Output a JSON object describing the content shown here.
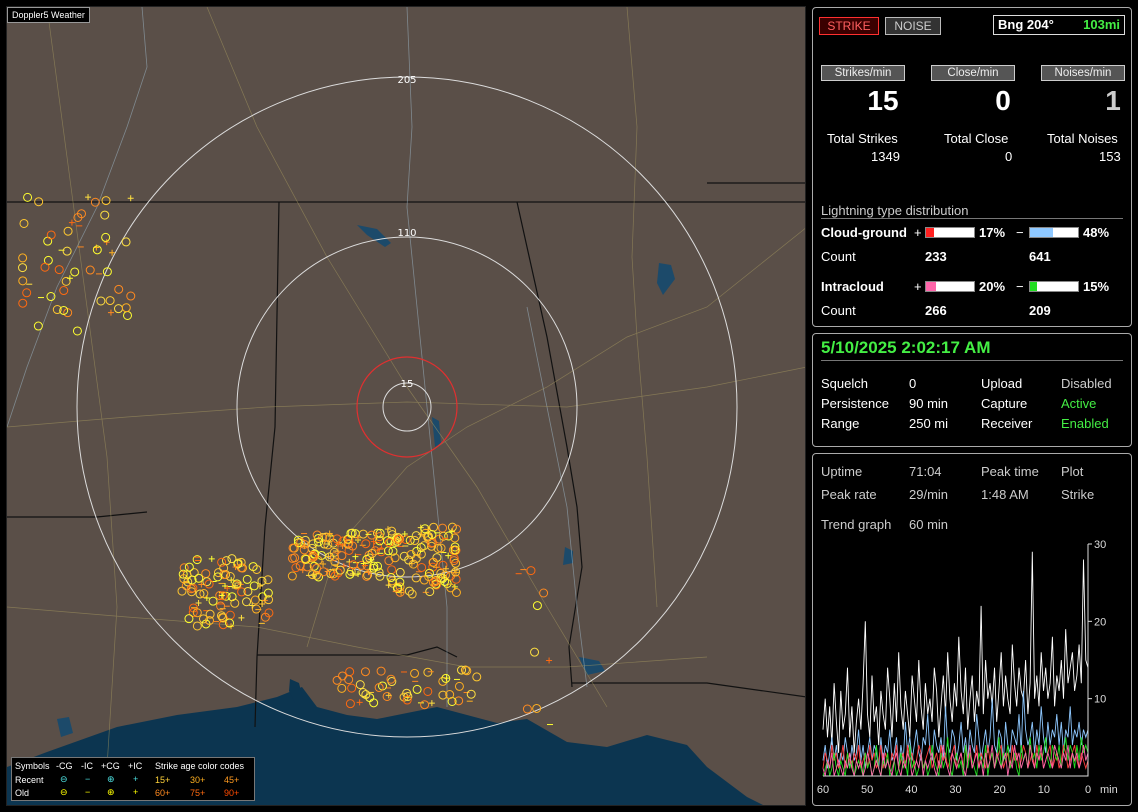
{
  "app": {
    "title": "Doppler5 Weather"
  },
  "map": {
    "range_labels": [
      "205",
      "110",
      "15"
    ],
    "colors": {
      "land": "#5a4f48",
      "water": "#0c3550",
      "rings": "#dcdcdc",
      "close_ring": "#e03030"
    }
  },
  "legend": {
    "symbols_label": "Symbols",
    "col_headers": [
      "-CG",
      "-IC",
      "+CG",
      "+IC"
    ],
    "recent_label": "Recent",
    "old_label": "Old",
    "recent_symbols": [
      "⊖",
      "−",
      "⊕",
      "+"
    ],
    "old_symbols": [
      "⊖",
      "−",
      "⊕",
      "+"
    ],
    "age_title": "Strike age color codes",
    "ages_recent": [
      "15+",
      "30+",
      "45+"
    ],
    "ages_old": [
      "60+",
      "75+",
      "90+"
    ]
  },
  "status": {
    "strike_btn": "STRIKE",
    "noise_btn": "NOISE",
    "bearing": "Bng 204°",
    "distance": "103mi"
  },
  "rates": {
    "strikes_label": "Strikes/min",
    "close_label": "Close/min",
    "noises_label": "Noises/min",
    "strikes": "15",
    "close": "0",
    "noises": "1"
  },
  "totals": {
    "strikes_label": "Total Strikes",
    "close_label": "Total Close",
    "noises_label": "Total Noises",
    "strikes": "1349",
    "close": "0",
    "noises": "153"
  },
  "distribution": {
    "title": "Lightning type distribution",
    "cg_label": "Cloud-ground",
    "ic_label": "Intracloud",
    "count_label": "Count",
    "plus": "+",
    "minus": "−",
    "cg_pos_pct": "17%",
    "cg_neg_pct": "48%",
    "ic_pos_pct": "20%",
    "ic_neg_pct": "15%",
    "cg_pos_frac": 0.17,
    "cg_neg_frac": 0.48,
    "ic_pos_frac": 0.2,
    "ic_neg_frac": 0.15,
    "cg_pos_count": "233",
    "cg_neg_count": "641",
    "ic_pos_count": "266",
    "ic_neg_count": "209",
    "colors": {
      "cg_pos": "#ff2020",
      "cg_neg": "#8ec8ff",
      "ic_pos": "#ff66aa",
      "ic_neg": "#22dd22"
    }
  },
  "settings": {
    "datetime": "5/10/2025 2:02:17 AM",
    "squelch_label": "Squelch",
    "squelch": "0",
    "persistence_label": "Persistence",
    "persistence": "90 min",
    "range_label": "Range",
    "range": "250 mi",
    "upload_label": "Upload",
    "upload": "Disabled",
    "capture_label": "Capture",
    "capture": "Active",
    "receiver_label": "Receiver",
    "receiver": "Enabled"
  },
  "stats": {
    "uptime_label": "Uptime",
    "uptime": "71:04",
    "peak_time_label": "Peak time",
    "peak_time": "1:48 AM",
    "plot_label": "Plot",
    "plot": "Strike",
    "peak_rate_label": "Peak rate",
    "peak_rate": "29/min",
    "trend_label": "Trend graph",
    "trend": "60 min"
  },
  "chart_data": {
    "type": "line",
    "xlabel": "min",
    "x_ticks": [
      "60",
      "50",
      "40",
      "30",
      "20",
      "10",
      "0"
    ],
    "y_ticks": [
      "30",
      "20",
      "10"
    ],
    "xlim": [
      60,
      0
    ],
    "ylim": [
      0,
      30
    ],
    "series": [
      {
        "color": "#ffffff",
        "values": [
          6,
          10,
          5,
          9,
          4,
          12,
          7,
          3,
          11,
          6,
          8,
          14,
          5,
          9,
          3,
          7,
          10,
          6,
          12,
          20,
          8,
          5,
          13,
          7,
          9,
          4,
          11,
          8,
          6,
          14,
          10,
          5,
          12,
          7,
          16,
          9,
          6,
          11,
          8,
          5,
          13,
          10,
          7,
          15,
          9,
          6,
          12,
          8,
          10,
          7,
          14,
          11,
          5,
          9,
          13,
          8,
          16,
          10,
          7,
          12,
          9,
          18,
          11,
          8,
          14,
          6,
          10,
          13,
          7,
          11,
          9,
          22,
          8,
          15,
          10,
          12,
          9,
          14,
          7,
          11,
          16,
          9,
          13,
          10,
          8,
          17,
          12,
          9,
          14,
          11,
          10,
          15,
          8,
          12,
          29,
          10,
          13,
          9,
          16,
          11,
          14,
          10,
          12,
          18,
          9,
          13,
          11,
          15,
          10,
          19,
          12,
          14,
          16,
          11,
          13,
          17,
          12,
          28,
          15,
          14
        ]
      },
      {
        "color": "#8ec8ff",
        "values": [
          2,
          4,
          1,
          3,
          5,
          2,
          4,
          1,
          3,
          2,
          5,
          3,
          1,
          4,
          2,
          3,
          6,
          2,
          4,
          1,
          3,
          5,
          2,
          4,
          3,
          1,
          5,
          2,
          4,
          3,
          6,
          2,
          3,
          5,
          1,
          4,
          2,
          7,
          3,
          5,
          2,
          4,
          6,
          3,
          2,
          5,
          4,
          8,
          3,
          2,
          6,
          4,
          3,
          5,
          2,
          9,
          4,
          3,
          6,
          5,
          2,
          4,
          7,
          3,
          5,
          2,
          6,
          4,
          3,
          8,
          5,
          2,
          4,
          6,
          3,
          5,
          10,
          4,
          3,
          6,
          5,
          2,
          7,
          4,
          3,
          6,
          5,
          4,
          8,
          3,
          11,
          6,
          4,
          5,
          7,
          3,
          6,
          4,
          9,
          5,
          3,
          7,
          4,
          6,
          5,
          8,
          4,
          7,
          3,
          6,
          5,
          9,
          4,
          6,
          5,
          7,
          4,
          6,
          5,
          6
        ]
      },
      {
        "color": "#ff4040",
        "values": [
          1,
          3,
          2,
          1,
          4,
          2,
          3,
          1,
          2,
          4,
          1,
          3,
          2,
          1,
          3,
          2,
          4,
          1,
          2,
          3,
          1,
          4,
          2,
          3,
          1,
          2,
          4,
          1,
          3,
          2,
          1,
          3,
          2,
          4,
          1,
          2,
          3,
          1,
          4,
          2,
          3,
          1,
          2,
          4,
          3,
          1,
          2,
          3,
          4,
          1,
          2,
          3,
          1,
          4,
          2,
          3,
          1,
          2,
          3,
          4,
          1,
          2,
          3,
          1,
          4,
          2,
          3,
          1,
          2,
          4,
          1,
          3,
          2,
          1,
          4,
          2,
          3,
          1,
          2,
          3,
          4,
          1,
          2,
          3,
          1,
          4,
          2,
          3,
          1,
          2,
          4,
          3,
          1,
          2,
          3,
          1,
          4,
          2,
          3,
          1,
          2,
          3,
          4,
          1,
          2,
          3,
          1,
          2,
          4,
          3,
          1,
          2,
          3,
          4,
          2,
          1,
          3,
          2,
          1,
          2
        ]
      },
      {
        "color": "#22dd22",
        "values": [
          0,
          1,
          2,
          0,
          1,
          3,
          1,
          0,
          2,
          1,
          0,
          3,
          1,
          2,
          0,
          1,
          2,
          1,
          0,
          3,
          1,
          2,
          0,
          1,
          4,
          1,
          0,
          2,
          1,
          3,
          0,
          1,
          2,
          0,
          1,
          3,
          1,
          2,
          0,
          4,
          1,
          2,
          0,
          1,
          3,
          1,
          2,
          0,
          1,
          4,
          2,
          1,
          0,
          3,
          1,
          2,
          5,
          1,
          0,
          2,
          3,
          1,
          2,
          0,
          4,
          1,
          3,
          2,
          1,
          0,
          3,
          2,
          1,
          4,
          0,
          2,
          3,
          1,
          2,
          5,
          1,
          3,
          2,
          4,
          1,
          2,
          3,
          1,
          0,
          4,
          2,
          3,
          1,
          5,
          2,
          3,
          1,
          4,
          2,
          3,
          5,
          2,
          1,
          4,
          3,
          2,
          4,
          1,
          3,
          5,
          2,
          4,
          3,
          1,
          4,
          2,
          5,
          3,
          4,
          3
        ]
      },
      {
        "color": "#ff66aa",
        "values": [
          1,
          0,
          2,
          1,
          3,
          0,
          1,
          2,
          1,
          0,
          2,
          1,
          3,
          1,
          0,
          2,
          1,
          2,
          0,
          1,
          3,
          2,
          0,
          1,
          2,
          1,
          0,
          3,
          1,
          2,
          1,
          0,
          2,
          3,
          1,
          0,
          2,
          1,
          3,
          2,
          0,
          1,
          2,
          1,
          3,
          0,
          2,
          1,
          2,
          3,
          1,
          0,
          2,
          1,
          4,
          2,
          1,
          0,
          3,
          2,
          1,
          2,
          3,
          1,
          0,
          2,
          4,
          1,
          2,
          3,
          1,
          2,
          0,
          3,
          1,
          2,
          4,
          1,
          3,
          2,
          1,
          2,
          3,
          0,
          2,
          1,
          4,
          2,
          3,
          1,
          2,
          3,
          1,
          4,
          2,
          1,
          3,
          2,
          4,
          1,
          2,
          3,
          2,
          1,
          4,
          3,
          2,
          1,
          3,
          2,
          4,
          1,
          3,
          2,
          3,
          1,
          2,
          4,
          2,
          3
        ]
      }
    ]
  }
}
